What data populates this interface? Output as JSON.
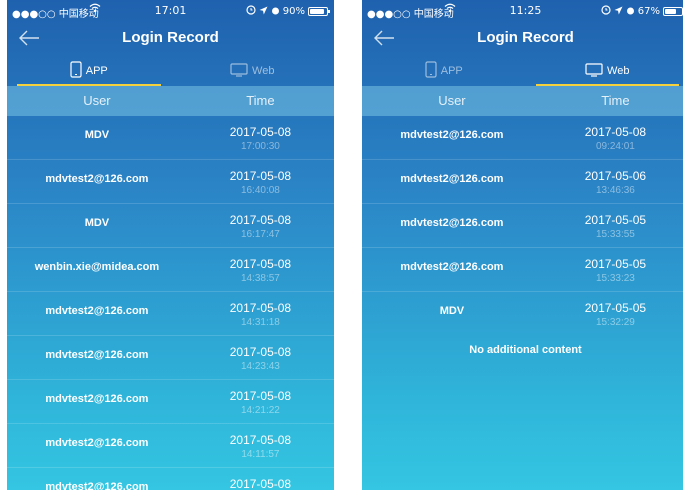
{
  "left": {
    "status": {
      "carrier": "●●●○○ 中国移动",
      "time": "17:01",
      "battery": "90%",
      "battery_level": 0.9
    },
    "nav": {
      "title": "Login Record"
    },
    "tabs": {
      "app": "APP",
      "web": "Web"
    },
    "columns": {
      "user": "User",
      "time": "Time"
    },
    "records": [
      {
        "user": "MDV",
        "date": "2017-05-08",
        "time": "17:00:30"
      },
      {
        "user": "mdvtest2@126.com",
        "date": "2017-05-08",
        "time": "16:40:08"
      },
      {
        "user": "MDV",
        "date": "2017-05-08",
        "time": "16:17:47"
      },
      {
        "user": "wenbin.xie@midea.com",
        "date": "2017-05-08",
        "time": "14:38:57"
      },
      {
        "user": "mdvtest2@126.com",
        "date": "2017-05-08",
        "time": "14:31:18"
      },
      {
        "user": "mdvtest2@126.com",
        "date": "2017-05-08",
        "time": "14:23:43"
      },
      {
        "user": "mdvtest2@126.com",
        "date": "2017-05-08",
        "time": "14:21:22"
      },
      {
        "user": "mdvtest2@126.com",
        "date": "2017-05-08",
        "time": "14:11:57"
      },
      {
        "user": "mdvtest2@126.com",
        "date": "2017-05-08",
        "time": ""
      }
    ]
  },
  "right": {
    "status": {
      "carrier": "●●●○○ 中国移动",
      "time": "11:25",
      "battery": "67%",
      "battery_level": 0.67
    },
    "nav": {
      "title": "Login Record"
    },
    "tabs": {
      "app": "APP",
      "web": "Web"
    },
    "columns": {
      "user": "User",
      "time": "Time"
    },
    "records": [
      {
        "user": "mdvtest2@126.com",
        "date": "2017-05-08",
        "time": "09:24:01"
      },
      {
        "user": "mdvtest2@126.com",
        "date": "2017-05-06",
        "time": "13:46:36"
      },
      {
        "user": "mdvtest2@126.com",
        "date": "2017-05-05",
        "time": "15:33:55"
      },
      {
        "user": "mdvtest2@126.com",
        "date": "2017-05-05",
        "time": "15:33:23"
      },
      {
        "user": "MDV",
        "date": "2017-05-05",
        "time": "15:32:29"
      }
    ],
    "empty_message": "No additional content"
  },
  "icons": {
    "back": "back-arrow-icon",
    "app_tab": "phone-icon",
    "web_tab": "monitor-icon",
    "wifi": "wifi-icon",
    "location": "location-arrow-icon",
    "alarm": "alarm-icon"
  },
  "colors": {
    "accent_underline": "#f4d13d",
    "gradient_top": "#1f61ae",
    "gradient_bottom": "#34c6e2"
  }
}
